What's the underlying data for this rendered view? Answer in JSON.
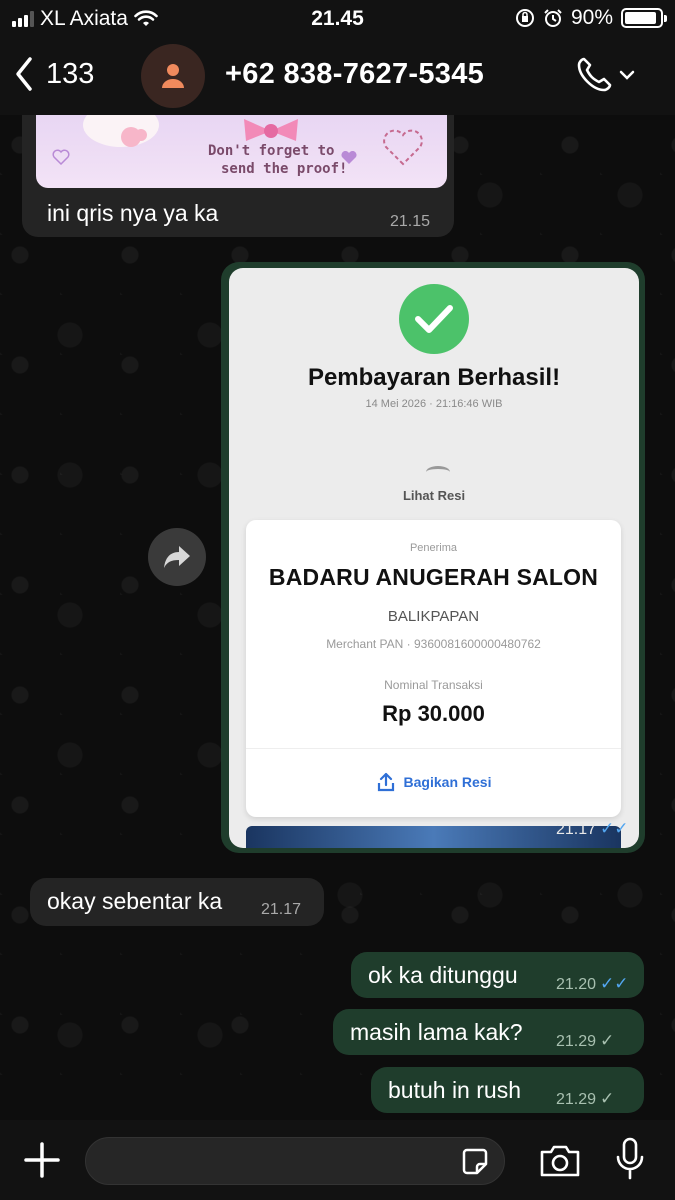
{
  "status_bar": {
    "carrier": "XL Axiata",
    "time": "21.45",
    "battery": "90%",
    "battery_level": 0.9
  },
  "header": {
    "back_count": "133",
    "contact": "+62 838-7627-5345"
  },
  "messages": [
    {
      "direction": "in",
      "sticker_text_1": "Don't forget to",
      "sticker_text_2": "send the proof!",
      "text": "ini qris nya ya ka",
      "time": "21.15"
    },
    {
      "direction": "out",
      "type": "image",
      "time": "21.17",
      "status": "read",
      "receipt": {
        "title": "Pembayaran Berhasil!",
        "date": "14 Mei 2026 · 21:16:46 WIB",
        "view_receipt": "Lihat Resi",
        "recipient_label": "Penerima",
        "merchant": "BADARU ANUGERAH SALON",
        "city": "BALIKPAPAN",
        "merchant_pan": "Merchant PAN · 9360081600000480762",
        "amount_label": "Nominal Transaksi",
        "amount": "Rp 30.000",
        "share": "Bagikan Resi"
      }
    },
    {
      "direction": "in",
      "text": "okay sebentar ka",
      "time": "21.17"
    },
    {
      "direction": "out",
      "text": "ok ka ditunggu",
      "time": "21.20",
      "status": "read"
    },
    {
      "direction": "out",
      "text": "masih lama kak?",
      "time": "21.29",
      "status": "sent"
    },
    {
      "direction": "out",
      "text": "butuh in rush",
      "time": "21.29",
      "status": "sent"
    }
  ],
  "icons": {
    "back": "chevron-left-icon",
    "avatar": "person-icon",
    "call": "phone-icon",
    "forward": "forward-arrow-icon",
    "attach": "plus-icon",
    "sticker": "sticker-icon",
    "camera": "camera-icon",
    "mic": "microphone-icon",
    "read_tick": "double-check-icon",
    "sent_tick": "single-check-icon"
  },
  "colors": {
    "outgoing_bubble": "#1f3d2c",
    "incoming_bubble": "#242424",
    "read_tick": "#53a6f0",
    "success_green": "#4cc26a"
  }
}
